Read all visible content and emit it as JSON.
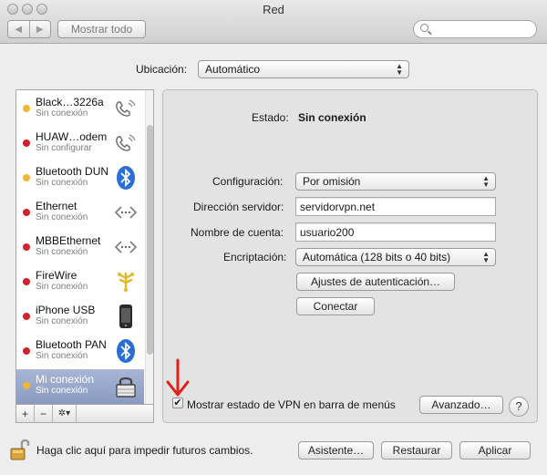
{
  "window": {
    "title": "Red"
  },
  "toolbar": {
    "back_glyph": "◀",
    "forward_glyph": "▶",
    "show_all_label": "Mostrar todo",
    "search_placeholder": ""
  },
  "location": {
    "label": "Ubicación:",
    "value": "Automático"
  },
  "services": [
    {
      "name": "Black…3226a",
      "status": "Sin conexión",
      "status_color": "#f2b630",
      "icon": "phone-modem-icon"
    },
    {
      "name": "HUAW…odem",
      "status": "Sin configurar",
      "status_color": "#d2212a",
      "icon": "phone-modem-icon"
    },
    {
      "name": "Bluetooth DUN",
      "status": "Sin conexión",
      "status_color": "#f2b630",
      "icon": "bluetooth-icon"
    },
    {
      "name": "Ethernet",
      "status": "Sin conexión",
      "status_color": "#d2212a",
      "icon": "ethernet-icon"
    },
    {
      "name": "MBBEthernet",
      "status": "Sin conexión",
      "status_color": "#d2212a",
      "icon": "ethernet-icon"
    },
    {
      "name": "FireWire",
      "status": "Sin conexión",
      "status_color": "#d2212a",
      "icon": "firewire-icon"
    },
    {
      "name": "iPhone USB",
      "status": "Sin conexión",
      "status_color": "#d2212a",
      "icon": "iphone-icon"
    },
    {
      "name": "Bluetooth PAN",
      "status": "Sin conexión",
      "status_color": "#d2212a",
      "icon": "bluetooth-icon"
    },
    {
      "name": "Mi conexión",
      "status": "Sin conexión",
      "status_color": "#f2b630",
      "icon": "vpn-lock-icon",
      "selected": true
    }
  ],
  "sidebar_actions": {
    "add": "+",
    "remove": "−",
    "gear": "✲▾"
  },
  "detail": {
    "status_label": "Estado:",
    "status_value": "Sin conexión",
    "config_label": "Configuración:",
    "config_value": "Por omisión",
    "server_label": "Dirección servidor:",
    "server_value": "servidorvpn.net",
    "account_label": "Nombre de cuenta:",
    "account_value": "usuario200",
    "encryption_label": "Encriptación:",
    "encryption_value": "Automática (128 bits o 40 bits)",
    "auth_button": "Ajustes de autenticación…",
    "connect_button": "Conectar",
    "show_vpn_label": "Mostrar estado de VPN en barra de menús",
    "show_vpn_checked": true,
    "check_glyph": "✔",
    "advanced_button": "Avanzado…",
    "help_glyph": "?"
  },
  "footer": {
    "lock_text": "Haga clic aquí para impedir futuros cambios.",
    "assistant_button": "Asistente…",
    "restore_button": "Restaurar",
    "apply_button": "Aplicar"
  },
  "colors": {
    "selection": "#8a9ac1",
    "annotation_arrow": "#e0201a",
    "bluetooth": "#2b6fd6"
  }
}
